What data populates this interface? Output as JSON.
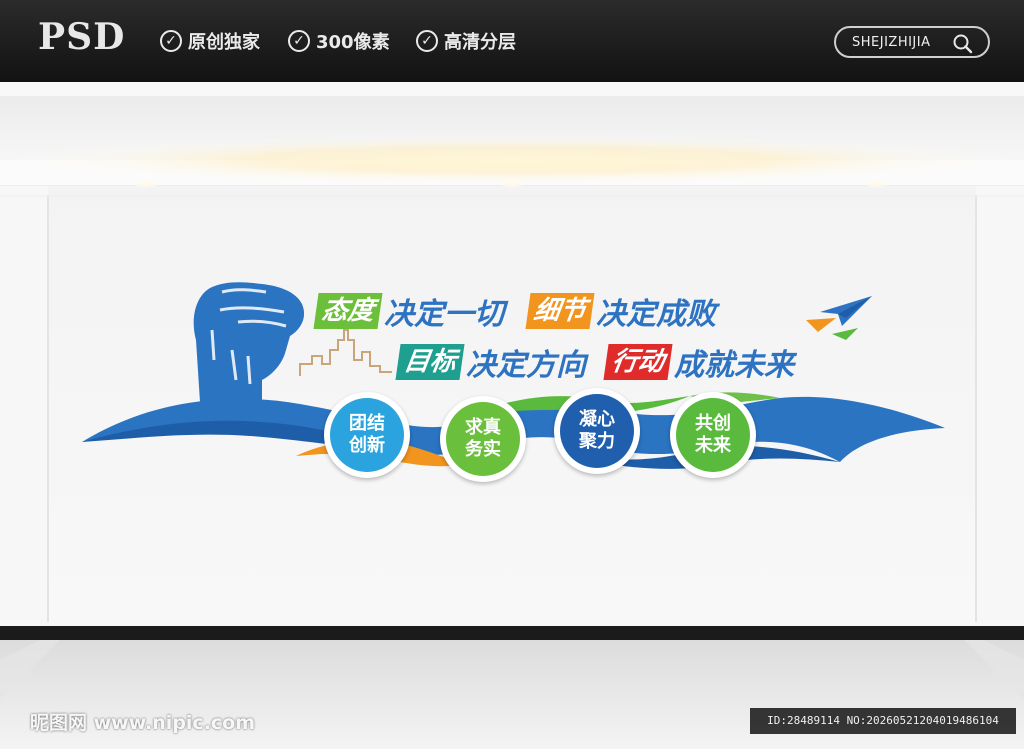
{
  "header": {
    "logo": "PSD",
    "features": [
      {
        "label": "原创独家"
      },
      {
        "label": "300像素"
      },
      {
        "label": "高清分层"
      }
    ],
    "search_label": "SHEJIZHIJIA"
  },
  "slogans": {
    "line1": [
      {
        "text": "态度",
        "style": "tag",
        "color": "#6bbf3a"
      },
      {
        "text": "决定一切",
        "style": "plain",
        "color": "#2d73c2"
      },
      {
        "text": "细节",
        "style": "tag",
        "color": "#f2951f"
      },
      {
        "text": "决定成败",
        "style": "plain",
        "color": "#2d73c2"
      }
    ],
    "line2": [
      {
        "text": "目标",
        "style": "tag",
        "color": "#1f9f8f"
      },
      {
        "text": "决定方向",
        "style": "plain",
        "color": "#2d73c2"
      },
      {
        "text": "行动",
        "style": "tag",
        "color": "#e02b2b"
      },
      {
        "text": "成就未来",
        "style": "plain",
        "color": "#2d73c2"
      }
    ]
  },
  "values": [
    {
      "line1": "团结",
      "line2": "创新",
      "color": "#2aa3de"
    },
    {
      "line1": "求真",
      "line2": "务实",
      "color": "#6abf3c"
    },
    {
      "line1": "凝心",
      "line2": "聚力",
      "color": "#1f5fae"
    },
    {
      "line1": "共创",
      "line2": "未来",
      "color": "#5aba3e"
    }
  ],
  "colors": {
    "brand_blue": "#2d73c2",
    "wave_blue": "#2b74c2",
    "accent_orange": "#f2951f",
    "accent_green": "#6bbf3a"
  },
  "footer": {
    "watermark": "昵图网 www.nipic.com",
    "id_text": "ID:28489114 NO:20260521204019486104"
  }
}
